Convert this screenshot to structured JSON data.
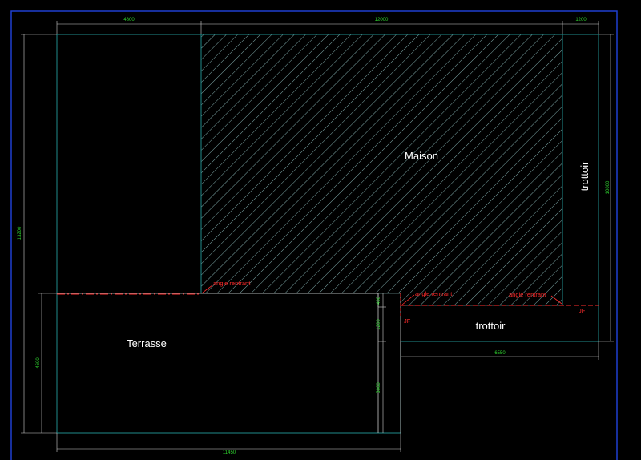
{
  "colors": {
    "background": "#000000",
    "outline": "#1f8c8c",
    "dimension": "#2fd62f",
    "hatch": "#9fd4d4",
    "annotation": "#ff2b2b",
    "label": "#ffffff",
    "frame": "#1f3fd0"
  },
  "labels": {
    "maison": "Maison",
    "terrasse": "Terrasse",
    "trottoir_vertical": "trottoir",
    "trottoir_horizontal": "trottoir"
  },
  "annotations": {
    "angle_left": "angle rentrant",
    "angle_middle": "angle rentrant",
    "angle_right": "angle rentrant",
    "jf_left": "JF",
    "jf_right": "JF"
  },
  "dimensions": {
    "top_left": "4800",
    "top_middle": "12000",
    "top_right": "1200",
    "right_height": "10000",
    "left_total": "13200",
    "left_terrasse": "4600",
    "terrasse_step": "400",
    "step_1200": "1200",
    "terrasse_lower": "3000",
    "bottom_width": "11450",
    "trottoir_width": "6550"
  }
}
